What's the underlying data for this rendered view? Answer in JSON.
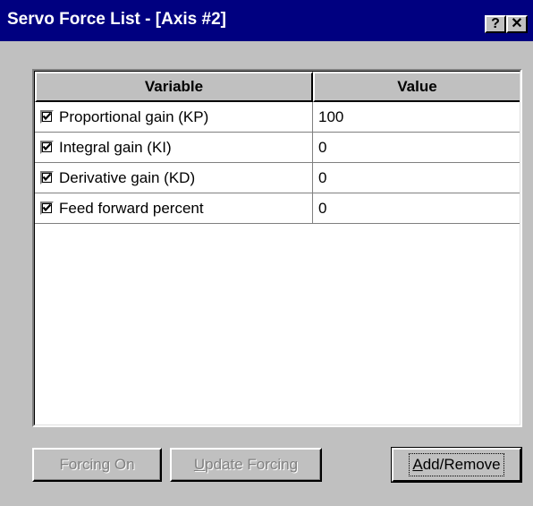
{
  "window": {
    "title": "Servo Force List - [Axis #2]",
    "help_label": "?",
    "close_label": "✕",
    "colors": {
      "titlebar": "#000080",
      "face": "#c0c0c0"
    }
  },
  "table": {
    "headers": {
      "variable": "Variable",
      "value": "Value"
    },
    "rows": [
      {
        "checked": true,
        "variable": "Proportional gain (KP)",
        "value": "100"
      },
      {
        "checked": true,
        "variable": "Integral gain (KI)",
        "value": "0"
      },
      {
        "checked": true,
        "variable": "Derivative gain (KD)",
        "value": "0"
      },
      {
        "checked": true,
        "variable": "Feed forward percent",
        "value": "0"
      }
    ]
  },
  "buttons": {
    "forcing_on": {
      "label": "Forcing On",
      "enabled": false
    },
    "update_forcing": {
      "first": "U",
      "rest": "pdate Forcing",
      "enabled": false
    },
    "add_remove": {
      "first": "A",
      "rest": "dd/Remove",
      "enabled": true
    }
  },
  "icons": {
    "checkbox": "checkmark-icon"
  }
}
